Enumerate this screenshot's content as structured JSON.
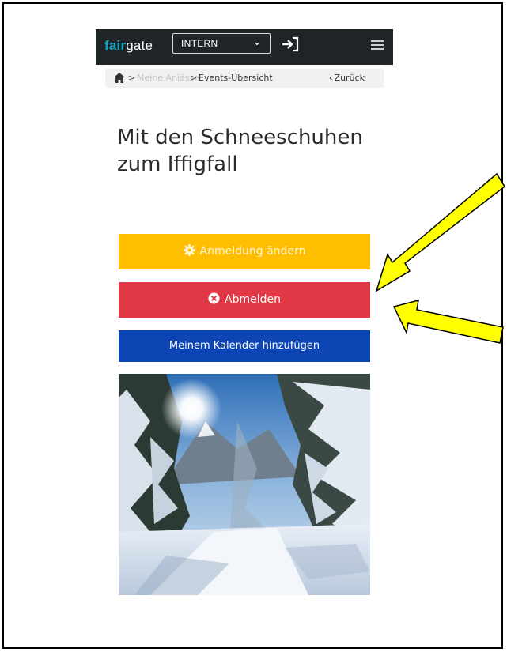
{
  "header": {
    "logo_fair": "fair",
    "logo_gate": "gate",
    "select_value": "INTERN",
    "login_icon": "sign-in-icon",
    "menu_icon": "hamburger-menu-icon"
  },
  "breadcrumb": {
    "home_icon": "home-icon",
    "separator": ">",
    "items": [
      "Meine Anlässe",
      "Events-Übersicht"
    ],
    "back_label": "Zurück"
  },
  "event": {
    "title": "Mit den Schneeschuhen zum Iffigfall"
  },
  "actions": {
    "change_registration": "Anmeldung ändern",
    "unregister": "Abmelden",
    "add_calendar": "Meinem Kalender hinzufügen"
  },
  "colors": {
    "topbar": "#1f2427",
    "logo_accent": "#14a5c8",
    "yellow_button": "#ffbe00",
    "red_button": "#e23744",
    "blue_button": "#0e45b4",
    "annotation_arrow": "#ffff00"
  }
}
